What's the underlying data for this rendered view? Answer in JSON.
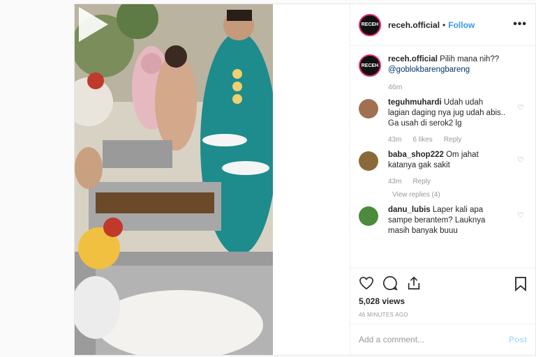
{
  "post": {
    "username": "receh.official",
    "follow_label": "Follow",
    "more_label": "•••",
    "avatar_text": "RECEH",
    "caption_text": "Pilih mana nih??",
    "caption_mention": "@goblokbarengbareng",
    "caption_time": "46m"
  },
  "comments": [
    {
      "user": "teguhmuhardi",
      "text": "Udah udah lagian daging nya jug udah abis.. Ga usah di serok2 lg",
      "time": "43m",
      "likes": "6 likes",
      "reply": "Reply",
      "avatar_color": "#a07050"
    },
    {
      "user": "baba_shop222",
      "text": "Om jahat katanya gak sakit",
      "time": "43m",
      "reply": "Reply",
      "view_replies": "View replies (4)",
      "avatar_color": "#8a6a3a"
    },
    {
      "user": "danu_lubis",
      "text": "Laper kali apa sampe berantem? Lauknya masih banyak buuu",
      "avatar_color": "#4c8a3c"
    }
  ],
  "stats": {
    "views": "5,028 views",
    "ago": "46 MINUTES AGO"
  },
  "add_comment": {
    "placeholder": "Add a comment...",
    "post_label": "Post"
  },
  "icons": [
    "heart-icon",
    "comment-icon",
    "share-icon",
    "bookmark-icon",
    "play-icon"
  ]
}
